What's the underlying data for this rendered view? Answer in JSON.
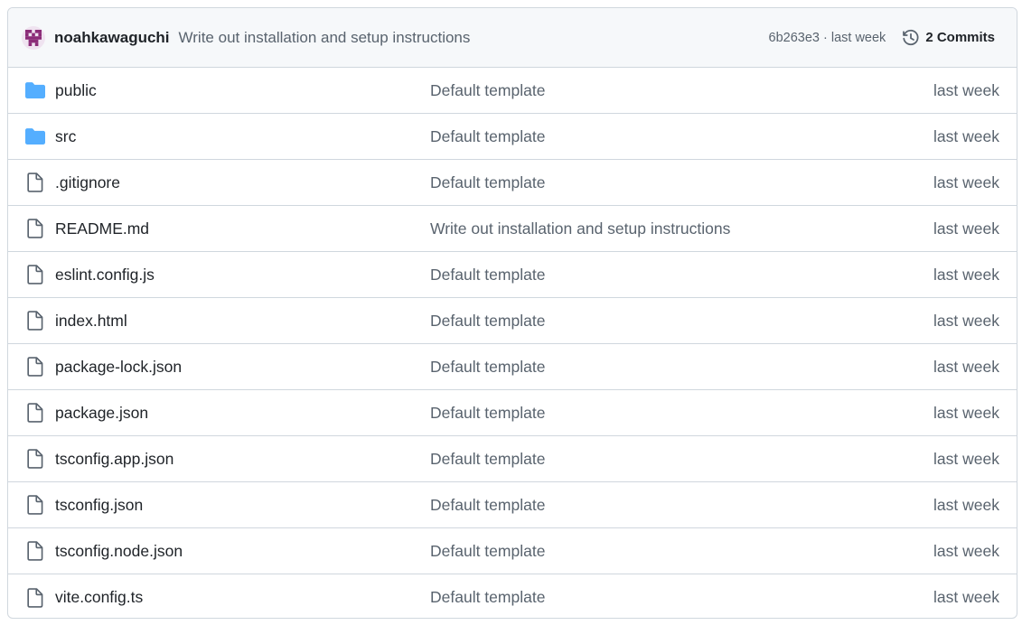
{
  "latest_commit": {
    "author": "noahkawaguchi",
    "message": "Write out installation and setup instructions",
    "sha_time": "6b263e3 · last week",
    "commits_label": "2 Commits",
    "avatar_icon": "identicon-avatar",
    "history_icon": "history-clock-icon"
  },
  "colors": {
    "folder": "#54aeff",
    "file_icon": "#59636e",
    "border": "#d0d7de",
    "header_bg": "#f6f8fa",
    "muted_text": "#59636e",
    "avatar": "#8b2c78"
  },
  "files": [
    {
      "type": "folder",
      "icon": "folder-icon",
      "name": "public",
      "message": "Default template",
      "age": "last week"
    },
    {
      "type": "folder",
      "icon": "folder-icon",
      "name": "src",
      "message": "Default template",
      "age": "last week"
    },
    {
      "type": "file",
      "icon": "file-icon",
      "name": ".gitignore",
      "message": "Default template",
      "age": "last week"
    },
    {
      "type": "file",
      "icon": "file-icon",
      "name": "README.md",
      "message": "Write out installation and setup instructions",
      "age": "last week"
    },
    {
      "type": "file",
      "icon": "file-icon",
      "name": "eslint.config.js",
      "message": "Default template",
      "age": "last week"
    },
    {
      "type": "file",
      "icon": "file-icon",
      "name": "index.html",
      "message": "Default template",
      "age": "last week"
    },
    {
      "type": "file",
      "icon": "file-icon",
      "name": "package-lock.json",
      "message": "Default template",
      "age": "last week"
    },
    {
      "type": "file",
      "icon": "file-icon",
      "name": "package.json",
      "message": "Default template",
      "age": "last week"
    },
    {
      "type": "file",
      "icon": "file-icon",
      "name": "tsconfig.app.json",
      "message": "Default template",
      "age": "last week"
    },
    {
      "type": "file",
      "icon": "file-icon",
      "name": "tsconfig.json",
      "message": "Default template",
      "age": "last week"
    },
    {
      "type": "file",
      "icon": "file-icon",
      "name": "tsconfig.node.json",
      "message": "Default template",
      "age": "last week"
    },
    {
      "type": "file",
      "icon": "file-icon",
      "name": "vite.config.ts",
      "message": "Default template",
      "age": "last week"
    }
  ]
}
